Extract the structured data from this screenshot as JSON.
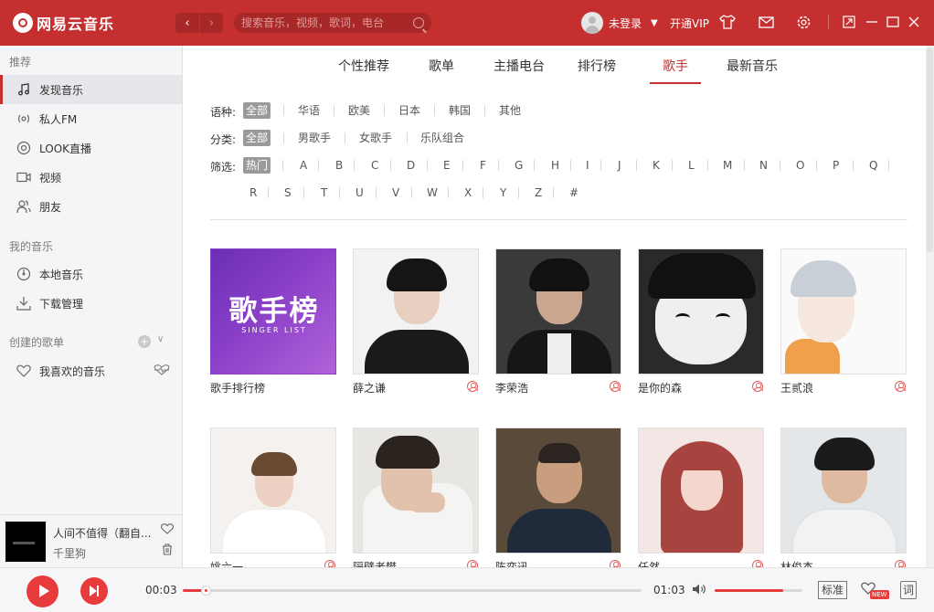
{
  "app": {
    "title": "网易云音乐"
  },
  "header": {
    "back_icon": "chevron-left-icon",
    "forward_icon": "chevron-right-icon",
    "search_placeholder": "搜索音乐，视频，歌词，电台",
    "user_label": "未登录",
    "vip_label": "开通VIP"
  },
  "sidebar": {
    "section_recommend": "推荐",
    "recommend_items": [
      {
        "label": "发现音乐",
        "icon": "music-note-icon"
      },
      {
        "label": "私人FM",
        "icon": "radio-icon"
      },
      {
        "label": "LOOK直播",
        "icon": "live-icon"
      },
      {
        "label": "视频",
        "icon": "video-icon"
      },
      {
        "label": "朋友",
        "icon": "friends-icon"
      }
    ],
    "section_my_music": "我的音乐",
    "my_music_items": [
      {
        "label": "本地音乐",
        "icon": "disc-icon"
      },
      {
        "label": "下载管理",
        "icon": "download-icon"
      }
    ],
    "section_created": "创建的歌单",
    "created_items": [
      {
        "label": "我喜欢的音乐",
        "icon": "heart-icon"
      }
    ]
  },
  "now_playing": {
    "title": "人间不值得（翻自...",
    "artist": "千里狗"
  },
  "tabs": [
    {
      "label": "个性推荐"
    },
    {
      "label": "歌单"
    },
    {
      "label": "主播电台"
    },
    {
      "label": "排行榜"
    },
    {
      "label": "歌手",
      "active": true
    },
    {
      "label": "最新音乐"
    }
  ],
  "filters": {
    "language": {
      "label": "语种:",
      "options": [
        "全部",
        "华语",
        "欧美",
        "日本",
        "韩国",
        "其他"
      ],
      "selected": "全部"
    },
    "category": {
      "label": "分类:",
      "options": [
        "全部",
        "男歌手",
        "女歌手",
        "乐队组合"
      ],
      "selected": "全部"
    },
    "index": {
      "label": "筛选:",
      "options_row1": [
        "热门",
        "A",
        "B",
        "C",
        "D",
        "E",
        "F",
        "G",
        "H",
        "I",
        "J",
        "K",
        "L",
        "M",
        "N",
        "O",
        "P",
        "Q"
      ],
      "options_row2": [
        "R",
        "S",
        "T",
        "U",
        "V",
        "W",
        "X",
        "Y",
        "Z",
        "#"
      ],
      "selected": "热门"
    }
  },
  "artists_row1": [
    {
      "name": "歌手排行榜",
      "badge_main": "歌手榜",
      "badge_sub": "SINGER LIST",
      "has_user_icon": false
    },
    {
      "name": "薛之谦",
      "has_user_icon": true
    },
    {
      "name": "李荣浩",
      "has_user_icon": true
    },
    {
      "name": "是你的森",
      "has_user_icon": true
    },
    {
      "name": "王贰浪",
      "has_user_icon": true
    }
  ],
  "artists_row2": [
    {
      "name": "姚六一",
      "has_user_icon": true
    },
    {
      "name": "隔壁老樊",
      "has_user_icon": true
    },
    {
      "name": "陈奕迅",
      "has_user_icon": true
    },
    {
      "name": "任然",
      "has_user_icon": true
    },
    {
      "name": "林俊杰",
      "has_user_icon": true
    }
  ],
  "player": {
    "current_time": "00:03",
    "total_time": "01:03",
    "progress": 0.05,
    "volume": 0.78,
    "quality_label": "标准",
    "effect_new_badge": "NEW",
    "lyric_label": "词"
  },
  "colors": {
    "accent": "#c62f2f",
    "play_button": "#e83c3c"
  }
}
